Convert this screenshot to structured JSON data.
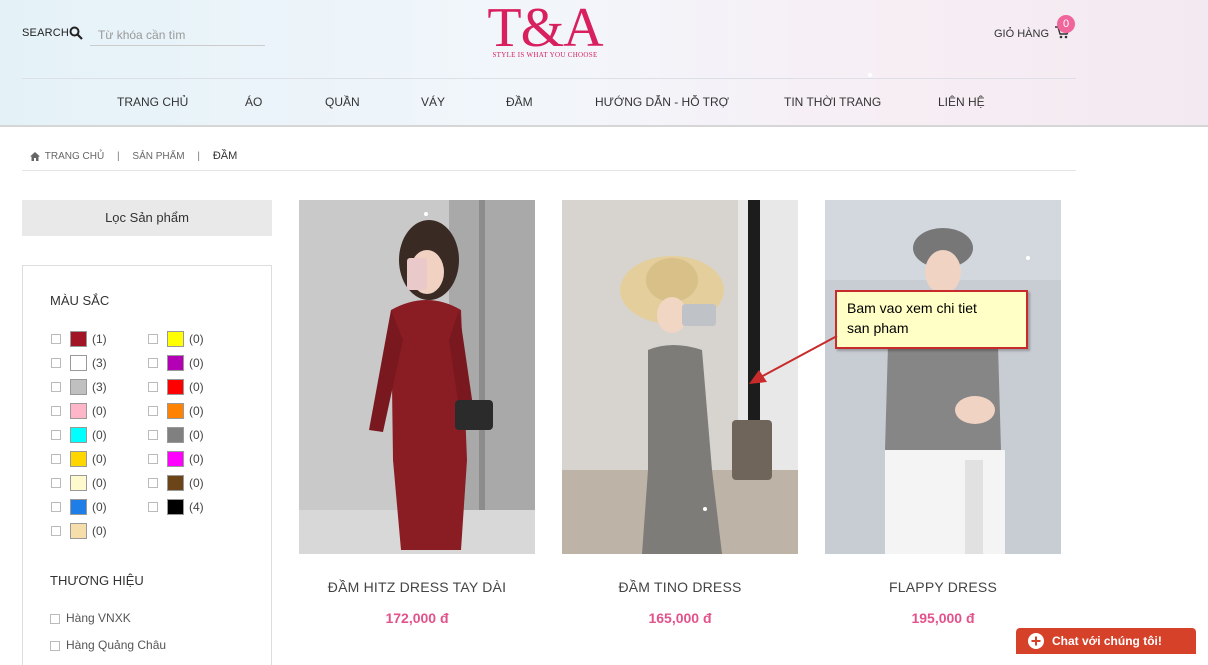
{
  "header": {
    "search_label": "SEARCH",
    "search_placeholder": "Từ khóa cần tìm",
    "logo_text": "T&A",
    "logo_tagline": "STYLE IS WHAT YOU CHOOSE",
    "cart_label": "GIỎ HÀNG",
    "cart_count": "0",
    "brand_color": "#d9205e"
  },
  "nav": {
    "items": [
      "TRANG CHỦ",
      "ÁO",
      "QUẦN",
      "VÁY",
      "ĐẦM",
      "HƯỚNG DẪN - HỖ TRỢ",
      "TIN THỜI TRANG",
      "LIÊN HỆ"
    ]
  },
  "breadcrumb": {
    "home": "TRANG CHỦ",
    "section": "SẢN PHẨM",
    "current": "ĐẦM",
    "sep": "|"
  },
  "filter": {
    "title": "Lọc Sản phẩm",
    "color_section": "MÀU SẮC",
    "colors": [
      {
        "hex": "#a11425",
        "count": "(1)"
      },
      {
        "hex": "#ffff00",
        "count": "(0)"
      },
      {
        "hex": "#ffffff",
        "count": "(3)"
      },
      {
        "hex": "#b400b4",
        "count": "(0)"
      },
      {
        "hex": "#c0c0c0",
        "count": "(3)"
      },
      {
        "hex": "#ff0000",
        "count": "(0)"
      },
      {
        "hex": "#ffb6c8",
        "count": "(0)"
      },
      {
        "hex": "#ff8200",
        "count": "(0)"
      },
      {
        "hex": "#00ffff",
        "count": "(0)"
      },
      {
        "hex": "#808080",
        "count": "(0)"
      },
      {
        "hex": "#ffd700",
        "count": "(0)"
      },
      {
        "hex": "#ff00ff",
        "count": "(0)"
      },
      {
        "hex": "#fffacd",
        "count": "(0)"
      },
      {
        "hex": "#6b4418",
        "count": "(0)"
      },
      {
        "hex": "#1e7ee8",
        "count": "(0)"
      },
      {
        "hex": "#000000",
        "count": "(4)"
      },
      {
        "hex": "#f6deaa",
        "count": "(0)"
      }
    ],
    "brand_section": "THƯƠNG HIỆU",
    "brands": [
      "Hàng VNXK",
      "Hàng Quảng Châu"
    ]
  },
  "products": [
    {
      "name": "ĐẦM HITZ DRESS TAY DÀI",
      "price": "172,000 đ",
      "image": "woman-red-knit-dress"
    },
    {
      "name": "ĐẦM TINO DRESS",
      "price": "165,000 đ",
      "image": "woman-grey-dress-straw-hat"
    },
    {
      "name": "FLAPPY DRESS",
      "price": "195,000 đ",
      "image": "woman-grey-tunic-beret"
    }
  ],
  "callout": {
    "line1": "Bam vao xem chi tiet",
    "line2": "san pham"
  },
  "chat": {
    "label": "Chat với chúng tôi!"
  },
  "accent_price_color": "#e2528b"
}
